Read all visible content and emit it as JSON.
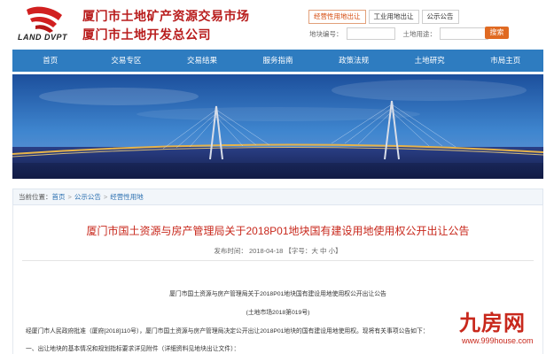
{
  "header": {
    "logo_text": "LAND DVPT",
    "org_line1": "厦门市土地矿产资源交易市场",
    "org_line2": "厦门市土地开发总公司"
  },
  "tabs": [
    {
      "label": "经营性用地出让"
    },
    {
      "label": "工业用地出让"
    },
    {
      "label": "公示公告"
    }
  ],
  "search": {
    "parcel_no_label": "地块编号：",
    "parcel_use_label": "土地用途：",
    "button_label": "搜索"
  },
  "nav": [
    {
      "label": "首页"
    },
    {
      "label": "交易专区"
    },
    {
      "label": "交易结果"
    },
    {
      "label": "服务指南"
    },
    {
      "label": "政策法规"
    },
    {
      "label": "土地研究"
    },
    {
      "label": "市局主页"
    }
  ],
  "breadcrumb": {
    "prefix": "当前位置：",
    "items": [
      "首页",
      "公示公告",
      "经营性用地"
    ]
  },
  "article": {
    "title": "厦门市国土资源与房产管理局关于2018P01地块国有建设用地使用权公开出让公告",
    "meta": "发布时间： 2018-04-18 【字号：大 中 小】",
    "p1": "厦门市国土资源与房产管理局关于2018P01地块国有建设用地使用权公开出让公告",
    "p2": "(土地市场2018第019号)",
    "p3": "经厦门市人民政府批准（厦府[2018]110号），厦门市国土资源与房产管理局决定公开出让2018P01地块的国有建设用地使用权。现将有关事项公告如下：",
    "p4": "一、出让地块的基本情况和规划指标要求详见附件（详细资料见地块出让文件）："
  },
  "watermark": {
    "text": "九房网",
    "url": "www.999house.com"
  },
  "colors": {
    "brand_red": "#b81c1c",
    "nav_blue": "#2e7cc0",
    "accent_orange": "#e06a22"
  }
}
